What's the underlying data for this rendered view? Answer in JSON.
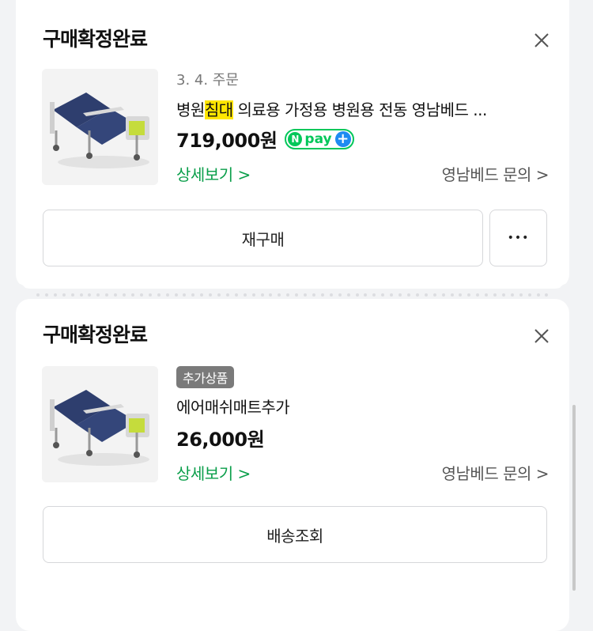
{
  "orders": [
    {
      "status": "구매확정완료",
      "date": "3. 4. 주문",
      "product_name_prefix": "병원",
      "product_name_highlight": "침대",
      "product_name_suffix": " 의료용 가정용 병원용 전동 영남베드 ...",
      "price": "719,000원",
      "npay_n": "N",
      "npay_label": "pay",
      "npay_plus": "+",
      "detail_link": "상세보기 >",
      "seller_inquiry": "영남베드 문의 >",
      "primary_button": "재구매",
      "more_button": "•••"
    },
    {
      "status": "구매확정완료",
      "badge": "추가상품",
      "product_name": "에어매쉬매트추가",
      "price": "26,000원",
      "detail_link": "상세보기 >",
      "seller_inquiry": "영남베드 문의 >",
      "primary_button": "배송조회"
    }
  ],
  "colors": {
    "accent_green": "#03c75a",
    "link_green": "#0a9e4a",
    "highlight": "#ffe600",
    "npay_plus_blue": "#1e8bf2"
  }
}
